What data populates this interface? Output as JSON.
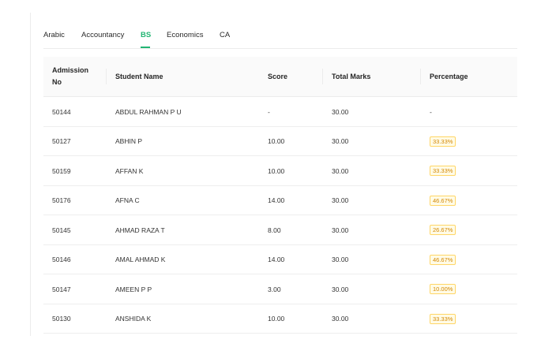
{
  "tabs": [
    {
      "label": "Arabic",
      "active": false
    },
    {
      "label": "Accountancy",
      "active": false
    },
    {
      "label": "BS",
      "active": true
    },
    {
      "label": "Economics",
      "active": false
    },
    {
      "label": "CA",
      "active": false
    }
  ],
  "colors": {
    "accent": "#22b573",
    "tag_text": "#d48806",
    "tag_bg": "#fffbe6",
    "tag_border": "#ffd666"
  },
  "table": {
    "headers": {
      "admission_line1": "Admission",
      "admission_line2": "No",
      "student_name": "Student Name",
      "score": "Score",
      "total_marks": "Total Marks",
      "percentage": "Percentage"
    },
    "rows": [
      {
        "admission_no": "50144",
        "name": "ABDUL RAHMAN P U",
        "score": "-",
        "total": "30.00",
        "percentage": "-",
        "tagged": false
      },
      {
        "admission_no": "50127",
        "name": "ABHIN P",
        "score": "10.00",
        "total": "30.00",
        "percentage": "33.33%",
        "tagged": true
      },
      {
        "admission_no": "50159",
        "name": "AFFAN K",
        "score": "10.00",
        "total": "30.00",
        "percentage": "33.33%",
        "tagged": true
      },
      {
        "admission_no": "50176",
        "name": "AFNA C",
        "score": "14.00",
        "total": "30.00",
        "percentage": "46.67%",
        "tagged": true
      },
      {
        "admission_no": "50145",
        "name": "AHMAD RAZA T",
        "score": "8.00",
        "total": "30.00",
        "percentage": "26.67%",
        "tagged": true
      },
      {
        "admission_no": "50146",
        "name": "AMAL AHMAD K",
        "score": "14.00",
        "total": "30.00",
        "percentage": "46.67%",
        "tagged": true
      },
      {
        "admission_no": "50147",
        "name": "AMEEN P P",
        "score": "3.00",
        "total": "30.00",
        "percentage": "10.00%",
        "tagged": true
      },
      {
        "admission_no": "50130",
        "name": "ANSHIDA K",
        "score": "10.00",
        "total": "30.00",
        "percentage": "33.33%",
        "tagged": true
      }
    ]
  }
}
